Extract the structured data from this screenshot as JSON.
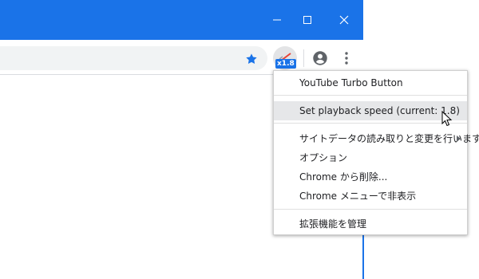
{
  "window": {
    "minimize_icon": "minimize-icon",
    "maximize_icon": "maximize-icon",
    "close_icon": "close-icon",
    "accent": "#1a73e8"
  },
  "toolbar": {
    "bookmark_icon": "star-icon",
    "extension_badge": "x1.8",
    "profile_icon": "account-circle-icon",
    "menu_icon": "kebab-menu-icon"
  },
  "context_menu": {
    "title": "YouTube Turbo Button",
    "playback_item": "Set playback speed (current: 1.8)",
    "site_data_item": "サイトデータの読み取りと変更を行います",
    "options_item": "オプション",
    "remove_item": "Chrome から削除...",
    "hide_item": "Chrome メニューで非表示",
    "manage_item": "拡張機能を管理"
  }
}
